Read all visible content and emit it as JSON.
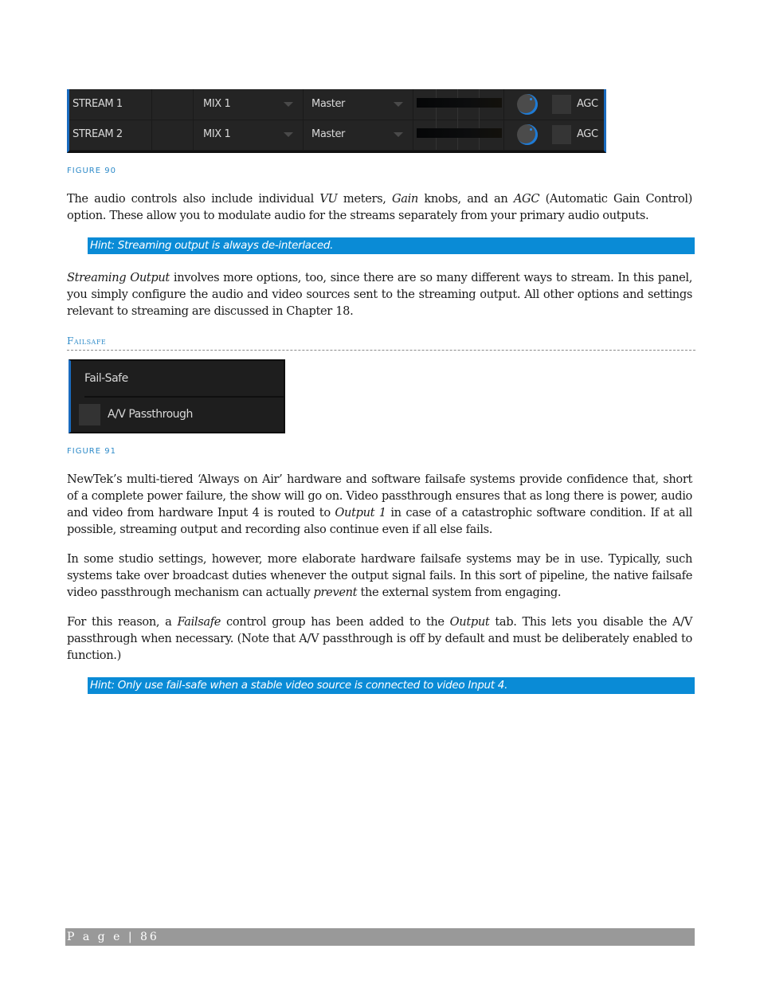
{
  "figure90": {
    "caption": "FIGURE 90",
    "rows": [
      {
        "name": "STREAM 1",
        "video_source": "MIX 1",
        "audio_source": "Master",
        "agc_label": "AGC",
        "agc_checked": false
      },
      {
        "name": "STREAM 2",
        "video_source": "MIX 1",
        "audio_source": "Master",
        "agc_label": "AGC",
        "agc_checked": false
      }
    ]
  },
  "para1": {
    "t1": "The audio controls also include individual ",
    "e1": "VU",
    "t2": " meters, ",
    "e2": "Gain",
    "t3": " knobs, and an ",
    "e3": "AGC",
    "t4": " (Automatic Gain Control) option.  These allow you to modulate audio for the streams separately from your primary audio outputs."
  },
  "hint1": "Hint: Streaming output is always de-interlaced.",
  "para2": {
    "e1": "Streaming Output",
    "t1": " involves more options, too, since there are so many different ways to stream.  In this panel, you simply configure the audio and video sources sent to the streaming output.  All other options and settings relevant to streaming are discussed in Chapter 18."
  },
  "section": {
    "title": "Failsafe"
  },
  "figure91": {
    "caption": "FIGURE 91",
    "panel_title": "Fail-Safe",
    "checkbox_label": "A/V Passthrough",
    "checked": false
  },
  "para3": {
    "t1": "NewTek’s multi-tiered ‘Always on Air’ hardware and software failsafe systems provide confidence that, short of a complete power failure, the show will go on. Video passthrough ensures that as long there is power, audio and video from hardware Input 4 is routed to ",
    "e1": "Output 1",
    "t2": " in case of a catastrophic software condition. If at all possible, streaming output and recording also continue even if all else fails."
  },
  "para4": {
    "t1": "In some studio settings, however, more elaborate hardware failsafe systems may be in use.  Typically, such systems take over broadcast duties whenever the output signal fails.  In this sort of pipeline, the native failsafe video passthrough mechanism can actually ",
    "e1": "prevent",
    "t2": " the external system from engaging."
  },
  "para5": {
    "t1": "For this reason, a ",
    "e1": "Failsafe",
    "t2": " control group has been added to the ",
    "e2": "Output",
    "t3": " tab.  This lets you disable the A/V passthrough when necessary.  (Note that A/V passthrough is off by default and must be deliberately enabled to function.)"
  },
  "hint2": "Hint: Only use fail-safe when a stable video source is connected to video Input 4.",
  "footer": {
    "label": "P a g e  |  86"
  },
  "colors": {
    "accent": "#0a8bd6",
    "caption": "#2e8bc9",
    "footer_bg": "#999999",
    "panel_bg": "#242424"
  }
}
